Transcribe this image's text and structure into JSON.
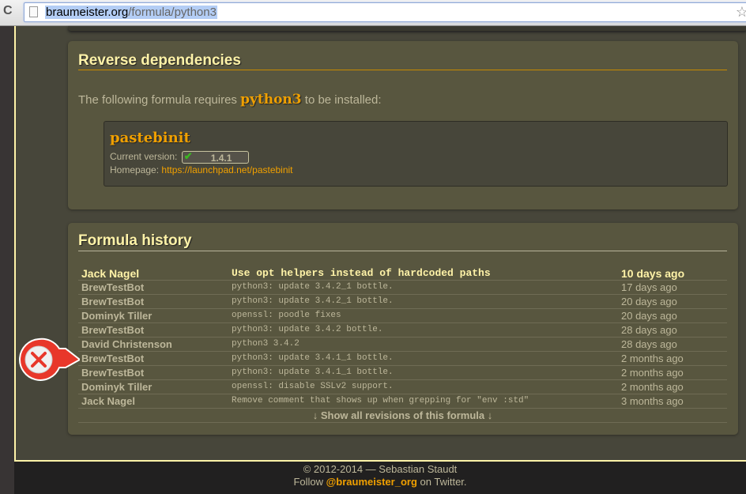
{
  "browser": {
    "url_host": "braumeister.org",
    "url_path": "/formula/python3"
  },
  "reverse_deps": {
    "title": "Reverse dependencies",
    "intro_before": "The following formula requires ",
    "formula": "python3",
    "intro_after": " to be installed:",
    "items": [
      {
        "name": "pastebinit",
        "version_label": "Current version:",
        "version": "1.4.1",
        "homepage_label": "Homepage:",
        "homepage": "https://launchpad.net/pastebinit"
      }
    ]
  },
  "history": {
    "title": "Formula history",
    "rows": [
      {
        "author": "Jack Nagel",
        "message": "Use opt helpers instead of hardcoded paths",
        "date": "10 days ago"
      },
      {
        "author": "BrewTestBot",
        "message": "python3: update 3.4.2_1 bottle.",
        "date": "17 days ago"
      },
      {
        "author": "BrewTestBot",
        "message": "python3: update 3.4.2_1 bottle.",
        "date": "20 days ago"
      },
      {
        "author": "Dominyk Tiller",
        "message": "openssl: poodle fixes",
        "date": "20 days ago"
      },
      {
        "author": "BrewTestBot",
        "message": "python3: update 3.4.2 bottle.",
        "date": "28 days ago"
      },
      {
        "author": "David Christenson",
        "message": "python3 3.4.2",
        "date": "28 days ago"
      },
      {
        "author": "BrewTestBot",
        "message": "python3: update 3.4.1_1 bottle.",
        "date": "2 months ago"
      },
      {
        "author": "BrewTestBot",
        "message": "python3: update 3.4.1_1 bottle.",
        "date": "2 months ago"
      },
      {
        "author": "Dominyk Tiller",
        "message": "openssl: disable SSLv2 support.",
        "date": "2 months ago"
      },
      {
        "author": "Jack Nagel",
        "message": "Remove comment that shows up when grepping for \"env :std\"",
        "date": "3 months ago"
      }
    ],
    "show_all": "↓ Show all revisions of this formula ↓"
  },
  "footer": {
    "copyright": "© 2012-2014 — Sebastian Staudt",
    "follow_before": "Follow ",
    "handle": "@braumeister_org",
    "follow_after": " on Twitter."
  },
  "colors": {
    "accent": "#f0a000",
    "title": "#fff3a8",
    "error": "#e8372a"
  }
}
